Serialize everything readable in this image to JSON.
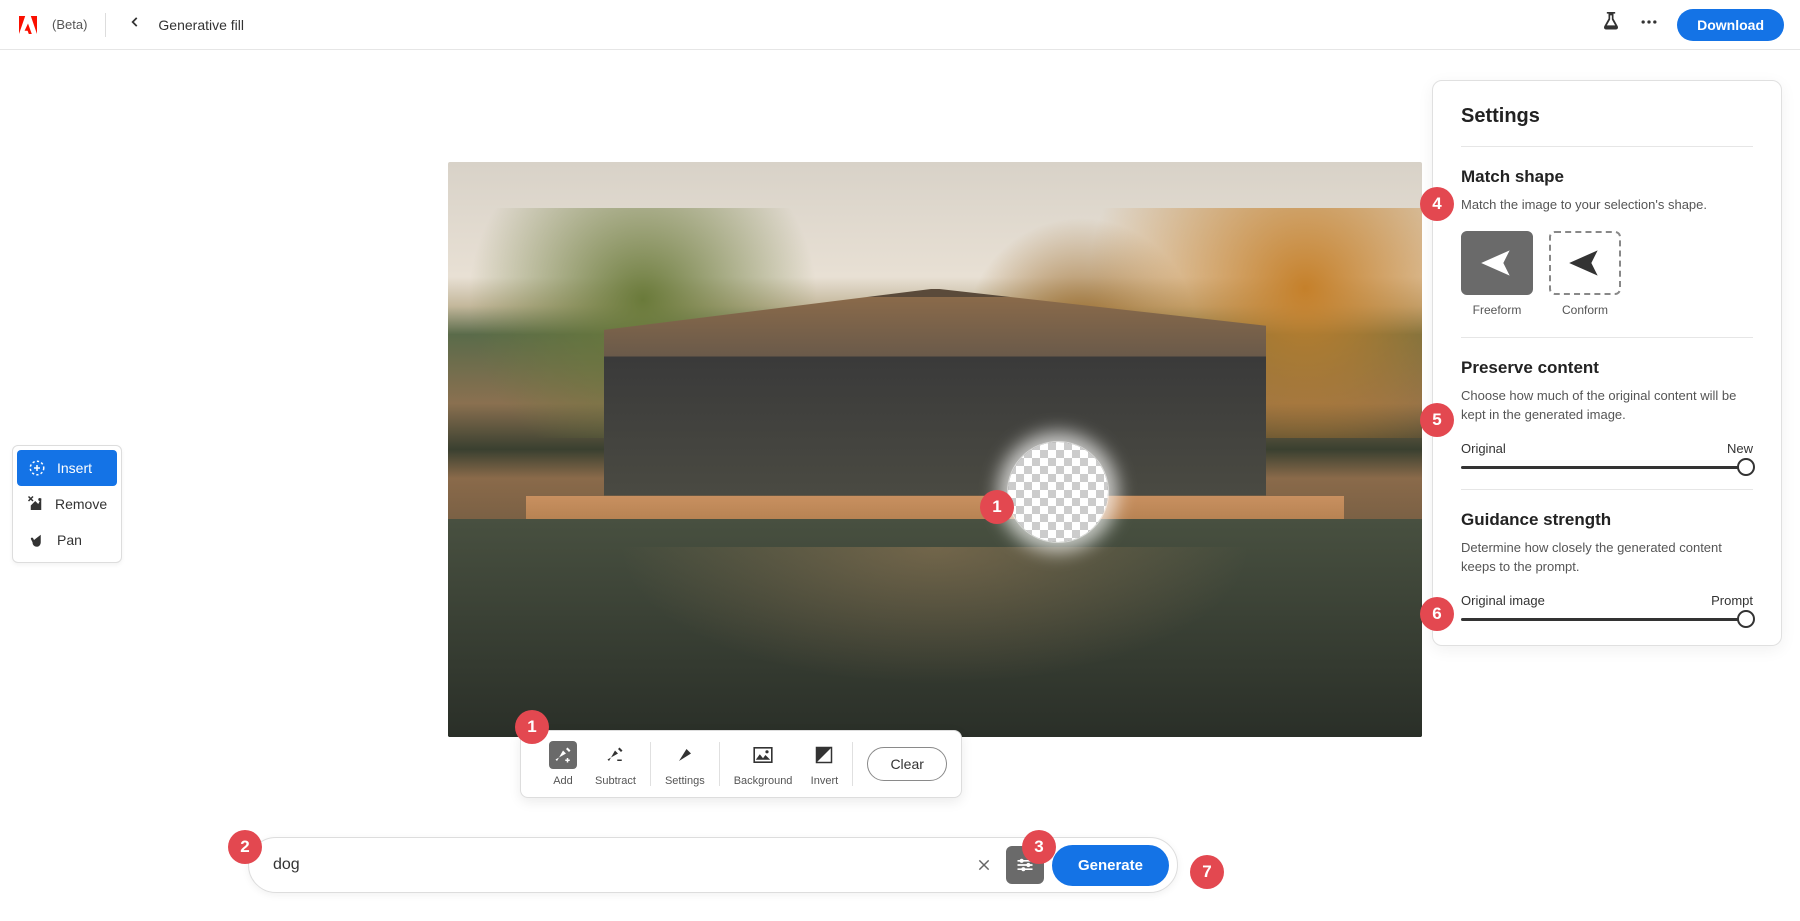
{
  "header": {
    "beta": "(Beta)",
    "title": "Generative fill",
    "download": "Download"
  },
  "leftToolbar": {
    "insert": "Insert",
    "remove": "Remove",
    "pan": "Pan"
  },
  "floatToolbar": {
    "add": "Add",
    "subtract": "Subtract",
    "settings": "Settings",
    "background": "Background",
    "invert": "Invert",
    "clear": "Clear"
  },
  "prompt": {
    "value": "dog",
    "generate": "Generate"
  },
  "settings": {
    "title": "Settings",
    "matchShape": {
      "heading": "Match shape",
      "desc": "Match the image to your selection's shape.",
      "freeform": "Freeform",
      "conform": "Conform"
    },
    "preserve": {
      "heading": "Preserve content",
      "desc": "Choose how much of the original content will be kept in the generated image.",
      "left": "Original",
      "right": "New"
    },
    "guidance": {
      "heading": "Guidance strength",
      "desc": "Determine how closely the generated content keeps to the prompt.",
      "left": "Original image",
      "right": "Prompt"
    }
  },
  "badges": {
    "b1": "1",
    "b1b": "1",
    "b2": "2",
    "b3": "3",
    "b4": "4",
    "b5": "5",
    "b6": "6",
    "b7": "7"
  }
}
